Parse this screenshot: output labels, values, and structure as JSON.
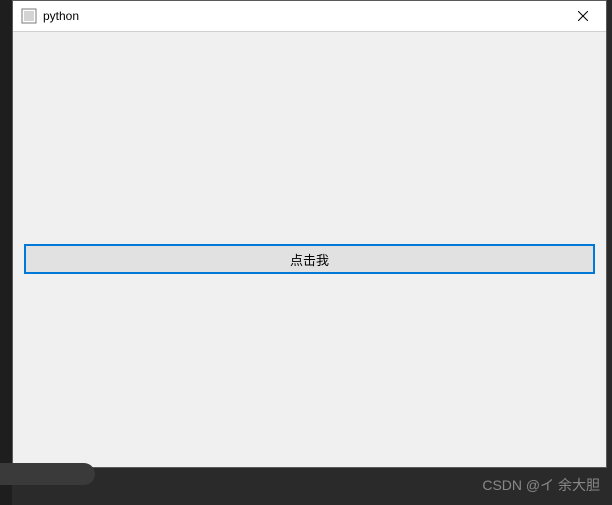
{
  "window": {
    "title": "python"
  },
  "client": {
    "button_label": "点击我"
  },
  "watermark": "CSDN @イ 余大胆"
}
